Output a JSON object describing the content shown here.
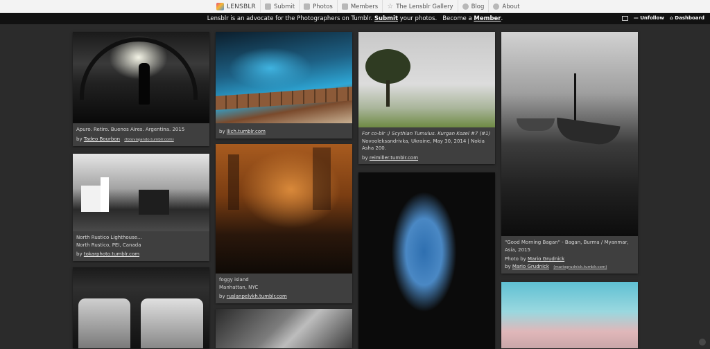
{
  "nav": {
    "brand": "LENSBLR",
    "items": [
      {
        "label": "Submit",
        "icon": "cloud-upload-icon"
      },
      {
        "label": "Photos",
        "icon": "photos-icon"
      },
      {
        "label": "Members",
        "icon": "members-icon"
      },
      {
        "label": "The Lensblr Gallery",
        "icon": "star-icon"
      },
      {
        "label": "Blog",
        "icon": "speech-bubble-icon"
      },
      {
        "label": "About",
        "icon": "info-icon"
      }
    ]
  },
  "bar": {
    "text_before": "Lensblr is an advocate for the Photographers on Tumblr.",
    "submit": "Submit",
    "text_middle": "your photos.",
    "become": "Become a",
    "member": "Member",
    "period": ".",
    "unfollow": "Unfollow",
    "dashboard": "Dashboard"
  },
  "posts": {
    "c1": {
      "line1": "Apuro. Retiro. Buenos Aires. Argentina. 2015",
      "by": "by",
      "author": "Tadeo Bourbon",
      "site": "(fotoviajando.tumblr.com)"
    },
    "c2": {
      "by": "by",
      "author": "llich.tumblr.com"
    },
    "c3": {
      "italic": "For co-blr :) Scythian Tumulus. Kurgan Kozel #7 (#1)",
      "line2": "Novooleksandrivka, Ukraine, May 30, 2014 | Nokia Asha 200.",
      "by": "by",
      "author": "reimiller.tumblr.com"
    },
    "c4": {
      "line1": "\"Good Morning Bagan\" - Bagan, Burma / Myanmar, Asia, 2015",
      "photo_by": "Photo by",
      "photographer": "Mario Grudnick",
      "by": "by",
      "author": "Mario Grudnick",
      "site": "(mariogrudnick.tumblr.com)"
    },
    "c5": {
      "line1": "North Rustico Lighthouse...",
      "line2": "North Rustico, PEI, Canada",
      "by": "by",
      "author": "tokarphoto.tumblr.com"
    },
    "c6": {
      "line1": "foggy island",
      "line2": "Manhattan, NYC",
      "by": "by",
      "author": "ruslanpelykh.tumblr.com"
    }
  }
}
